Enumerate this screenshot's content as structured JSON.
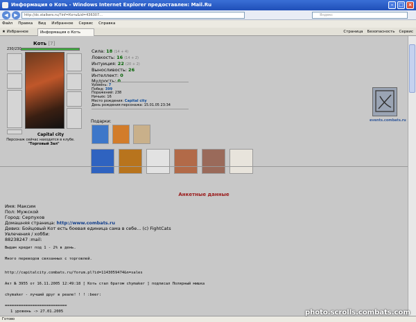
{
  "window": {
    "title": "Информация о Коть - Windows Internet Explorer предоставлен: Mail.Ru"
  },
  "addressbar": {
    "url": "http://dc.stalkers.ru/?inf=Коть&id=436307...",
    "search_placeholder": "Яндекс"
  },
  "menu": [
    "Файл",
    "Правка",
    "Вид",
    "Избранное",
    "Сервис",
    "Справка"
  ],
  "tabbar": {
    "favorites": "Избранное",
    "tab_title": "Информация о Коть",
    "tools": [
      "Страница",
      "Безопасность",
      "Сервис"
    ]
  },
  "character": {
    "name": "Коть",
    "level": "[7]",
    "hp": "230/230",
    "city": "Capital city",
    "location_line": "Персонаж сейчас находится в клубе.",
    "location_room": "\"Торговый Зал\"",
    "stats": [
      {
        "label": "Сила:",
        "value": "18",
        "extra": "(14 + 4)"
      },
      {
        "label": "Ловкость:",
        "value": "16",
        "extra": "(14 + 2)"
      },
      {
        "label": "Интуиция:",
        "value": "22",
        "extra": "(20 + 2)"
      },
      {
        "label": "Выносливость:",
        "value": "26",
        "extra": ""
      },
      {
        "label": "Интеллект:",
        "value": "0",
        "extra": ""
      },
      {
        "label": "Мудрость:",
        "value": "0",
        "extra": ""
      }
    ],
    "info": [
      {
        "label": "Уровень:",
        "value": "7"
      },
      {
        "label": "Побед:",
        "value": "399"
      },
      {
        "label": "Поражений:",
        "value": "238"
      },
      {
        "label": "Ничьих:",
        "value": "16"
      },
      {
        "label": "Место рождения:",
        "value": "Capital city"
      },
      {
        "label": "День рождения персонажа:",
        "value": "15.01.05 23:34"
      }
    ],
    "gifts_label": "Подарки:",
    "emblem_caption": "events.combats.ru"
  },
  "profile": {
    "heading": "Анкетные данные",
    "name": "Имя: Максим",
    "sex": "Пол: Мужской",
    "city": "Город: Серпухов",
    "homepage_label": "Домашняя страница:",
    "homepage_url": "http://www.combats.ru",
    "motto": "Девиз: Бойцовый Кот есть боевая единица сама в себе... (с) FightCats",
    "hobby": "Увлечения / хобби:",
    "icq": "88238247 :mail:",
    "text_lines": [
      "Выдам кредит под 1 - 2% в день.",
      "Много переводов связанных с торговлей.",
      "http://capitalcity.combats.ru/forum.pl?id=1143059474&n=sales",
      "Акт № 3955 от 16.11.2005 12:49:18 [ Коть стал братом chymaker ] подписал Полярный мишка",
      "chymaker - лучший друг в реале! ! ! :beer:",
      "===========================",
      "1 уровень -> 27.01.2005"
    ]
  },
  "status": {
    "text": "Готово"
  },
  "watermark": "photo.scrolls.combats.com"
}
